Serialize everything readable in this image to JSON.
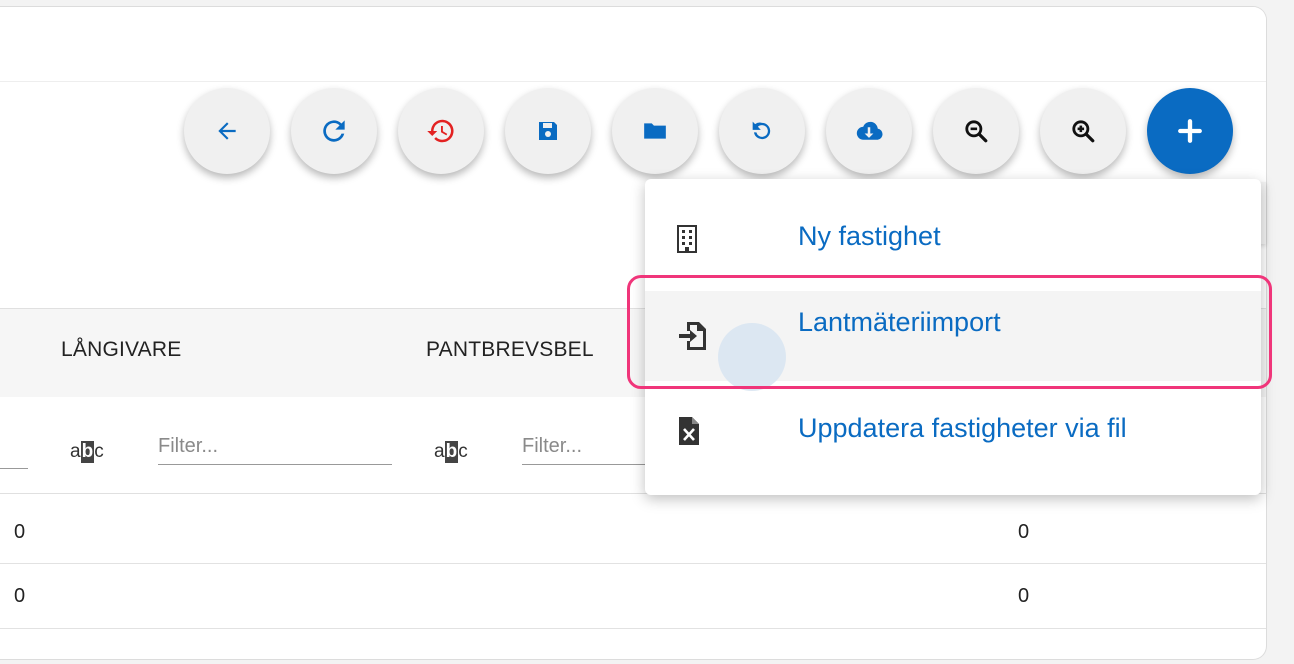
{
  "toolbar": {
    "buttons": [
      {
        "name": "back-button",
        "icon": "arrow-left-icon"
      },
      {
        "name": "refresh-button",
        "icon": "refresh-icon"
      },
      {
        "name": "history-button",
        "icon": "history-icon"
      },
      {
        "name": "save-button",
        "icon": "save-icon"
      },
      {
        "name": "open-folder-button",
        "icon": "folder-icon"
      },
      {
        "name": "undo-button",
        "icon": "undo-icon"
      },
      {
        "name": "cloud-download-button",
        "icon": "cloud-download-icon"
      },
      {
        "name": "zoom-out-button",
        "icon": "zoom-out-icon"
      },
      {
        "name": "zoom-in-button",
        "icon": "zoom-in-icon"
      },
      {
        "name": "add-button",
        "icon": "plus-icon"
      }
    ],
    "colors": {
      "primary": "#0a6bc2",
      "history": "#e32222",
      "icon": "#0a6bc2",
      "dark_icon": "#111111"
    }
  },
  "menu": {
    "items": [
      {
        "label": "Ny fastighet",
        "icon": "building-icon"
      },
      {
        "label": "Lantmäteriimport",
        "icon": "file-import-icon"
      },
      {
        "label": "Uppdatera fastigheter via fil",
        "icon": "excel-file-icon"
      }
    ],
    "highlight_color": "#f0357a"
  },
  "table": {
    "columns": [
      "LÅNGIVARE",
      "PANTBREVSBEL"
    ],
    "filter_type_glyph": {
      "a": "a",
      "b": "b",
      "c": "c"
    },
    "filter_placeholder": "Filter...",
    "rows": [
      {
        "left": "0",
        "right": "0"
      },
      {
        "left": "0",
        "right": "0"
      }
    ]
  }
}
